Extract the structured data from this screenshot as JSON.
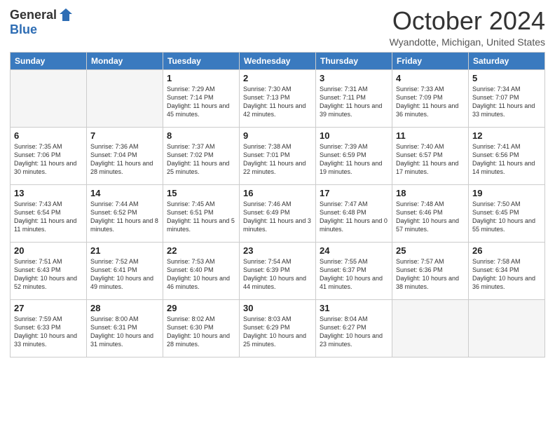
{
  "header": {
    "logo_general": "General",
    "logo_blue": "Blue",
    "month_title": "October 2024",
    "location": "Wyandotte, Michigan, United States"
  },
  "weekdays": [
    "Sunday",
    "Monday",
    "Tuesday",
    "Wednesday",
    "Thursday",
    "Friday",
    "Saturday"
  ],
  "weeks": [
    [
      {
        "day": "",
        "info": ""
      },
      {
        "day": "",
        "info": ""
      },
      {
        "day": "1",
        "info": "Sunrise: 7:29 AM\nSunset: 7:14 PM\nDaylight: 11 hours and 45 minutes."
      },
      {
        "day": "2",
        "info": "Sunrise: 7:30 AM\nSunset: 7:13 PM\nDaylight: 11 hours and 42 minutes."
      },
      {
        "day": "3",
        "info": "Sunrise: 7:31 AM\nSunset: 7:11 PM\nDaylight: 11 hours and 39 minutes."
      },
      {
        "day": "4",
        "info": "Sunrise: 7:33 AM\nSunset: 7:09 PM\nDaylight: 11 hours and 36 minutes."
      },
      {
        "day": "5",
        "info": "Sunrise: 7:34 AM\nSunset: 7:07 PM\nDaylight: 11 hours and 33 minutes."
      }
    ],
    [
      {
        "day": "6",
        "info": "Sunrise: 7:35 AM\nSunset: 7:06 PM\nDaylight: 11 hours and 30 minutes."
      },
      {
        "day": "7",
        "info": "Sunrise: 7:36 AM\nSunset: 7:04 PM\nDaylight: 11 hours and 28 minutes."
      },
      {
        "day": "8",
        "info": "Sunrise: 7:37 AM\nSunset: 7:02 PM\nDaylight: 11 hours and 25 minutes."
      },
      {
        "day": "9",
        "info": "Sunrise: 7:38 AM\nSunset: 7:01 PM\nDaylight: 11 hours and 22 minutes."
      },
      {
        "day": "10",
        "info": "Sunrise: 7:39 AM\nSunset: 6:59 PM\nDaylight: 11 hours and 19 minutes."
      },
      {
        "day": "11",
        "info": "Sunrise: 7:40 AM\nSunset: 6:57 PM\nDaylight: 11 hours and 17 minutes."
      },
      {
        "day": "12",
        "info": "Sunrise: 7:41 AM\nSunset: 6:56 PM\nDaylight: 11 hours and 14 minutes."
      }
    ],
    [
      {
        "day": "13",
        "info": "Sunrise: 7:43 AM\nSunset: 6:54 PM\nDaylight: 11 hours and 11 minutes."
      },
      {
        "day": "14",
        "info": "Sunrise: 7:44 AM\nSunset: 6:52 PM\nDaylight: 11 hours and 8 minutes."
      },
      {
        "day": "15",
        "info": "Sunrise: 7:45 AM\nSunset: 6:51 PM\nDaylight: 11 hours and 5 minutes."
      },
      {
        "day": "16",
        "info": "Sunrise: 7:46 AM\nSunset: 6:49 PM\nDaylight: 11 hours and 3 minutes."
      },
      {
        "day": "17",
        "info": "Sunrise: 7:47 AM\nSunset: 6:48 PM\nDaylight: 11 hours and 0 minutes."
      },
      {
        "day": "18",
        "info": "Sunrise: 7:48 AM\nSunset: 6:46 PM\nDaylight: 10 hours and 57 minutes."
      },
      {
        "day": "19",
        "info": "Sunrise: 7:50 AM\nSunset: 6:45 PM\nDaylight: 10 hours and 55 minutes."
      }
    ],
    [
      {
        "day": "20",
        "info": "Sunrise: 7:51 AM\nSunset: 6:43 PM\nDaylight: 10 hours and 52 minutes."
      },
      {
        "day": "21",
        "info": "Sunrise: 7:52 AM\nSunset: 6:41 PM\nDaylight: 10 hours and 49 minutes."
      },
      {
        "day": "22",
        "info": "Sunrise: 7:53 AM\nSunset: 6:40 PM\nDaylight: 10 hours and 46 minutes."
      },
      {
        "day": "23",
        "info": "Sunrise: 7:54 AM\nSunset: 6:39 PM\nDaylight: 10 hours and 44 minutes."
      },
      {
        "day": "24",
        "info": "Sunrise: 7:55 AM\nSunset: 6:37 PM\nDaylight: 10 hours and 41 minutes."
      },
      {
        "day": "25",
        "info": "Sunrise: 7:57 AM\nSunset: 6:36 PM\nDaylight: 10 hours and 38 minutes."
      },
      {
        "day": "26",
        "info": "Sunrise: 7:58 AM\nSunset: 6:34 PM\nDaylight: 10 hours and 36 minutes."
      }
    ],
    [
      {
        "day": "27",
        "info": "Sunrise: 7:59 AM\nSunset: 6:33 PM\nDaylight: 10 hours and 33 minutes."
      },
      {
        "day": "28",
        "info": "Sunrise: 8:00 AM\nSunset: 6:31 PM\nDaylight: 10 hours and 31 minutes."
      },
      {
        "day": "29",
        "info": "Sunrise: 8:02 AM\nSunset: 6:30 PM\nDaylight: 10 hours and 28 minutes."
      },
      {
        "day": "30",
        "info": "Sunrise: 8:03 AM\nSunset: 6:29 PM\nDaylight: 10 hours and 25 minutes."
      },
      {
        "day": "31",
        "info": "Sunrise: 8:04 AM\nSunset: 6:27 PM\nDaylight: 10 hours and 23 minutes."
      },
      {
        "day": "",
        "info": ""
      },
      {
        "day": "",
        "info": ""
      }
    ]
  ]
}
